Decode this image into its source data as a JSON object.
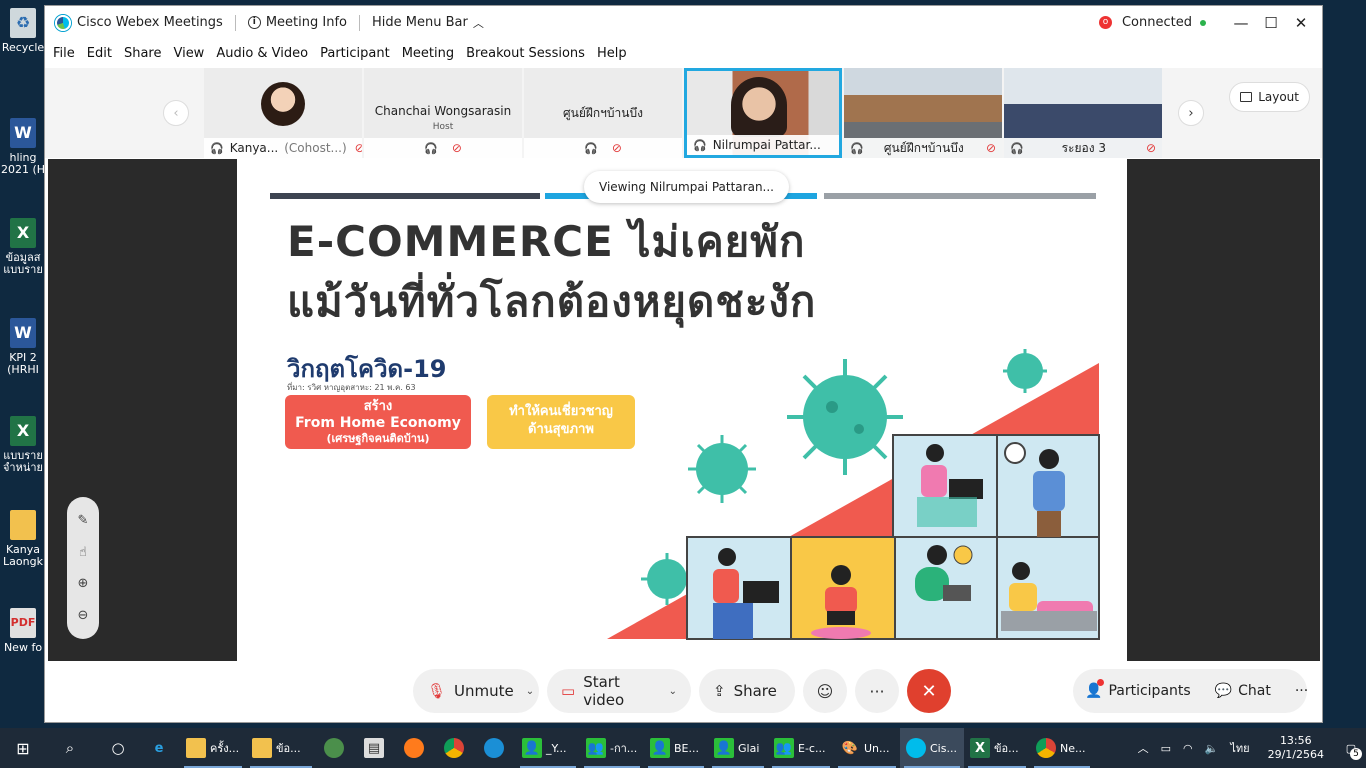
{
  "desktop": {
    "icons": [
      {
        "label": "Recycle",
        "type": "recycle",
        "glyph": "♻"
      },
      {
        "label": "hling 2021 (H",
        "type": "word",
        "glyph": "W"
      },
      {
        "label": "ข้อมูลส แบบราย",
        "type": "excel",
        "glyph": "X"
      },
      {
        "label": "KPI 2 (HRHI",
        "type": "word",
        "glyph": "W"
      },
      {
        "label": "แบบราย จำหน่าย",
        "type": "excel",
        "glyph": "X"
      },
      {
        "label": "Kanya Laongk",
        "type": "folder",
        "glyph": ""
      },
      {
        "label": "New fo",
        "type": "pdf",
        "glyph": "PDF"
      }
    ]
  },
  "titlebar": {
    "app_title": "Cisco Webex Meetings",
    "meeting_info": "Meeting Info",
    "hide_menu": "Hide Menu Bar",
    "status": "Connected"
  },
  "menu": [
    "File",
    "Edit",
    "Share",
    "View",
    "Audio & Video",
    "Participant",
    "Meeting",
    "Breakout Sessions",
    "Help"
  ],
  "participants": [
    {
      "name": "Kanya...",
      "role_tag": "(Cohost...)",
      "kind": "avatar"
    },
    {
      "name": "Chanchai Wongsarasin",
      "sub": "Host",
      "kind": "name-only"
    },
    {
      "name": "ศูนย์ฝึกฯบ้านบึง",
      "kind": "name-only"
    },
    {
      "name": "Nilrumpai Pattar...",
      "kind": "video-active"
    },
    {
      "name": "ศูนย์ฝึกฯบ้านบึง",
      "kind": "video"
    },
    {
      "name": "ระยอง 3",
      "kind": "video"
    }
  ],
  "layout_label": "Layout",
  "stage": {
    "viewing": "Viewing Nilrumpai Pattaran...",
    "slide": {
      "line1": "E-COMMERCE ไม่เคยพัก",
      "line2": "แม้วันที่ทั่วโลกต้องหยุดชะงัก",
      "covid_title": "วิกฤตโควิด-19",
      "covid_source": "ที่มา: รวิศ หาญอุตสาหะ: 21 พ.ค. 63",
      "box_red_1": "สร้าง",
      "box_red_2": "From Home Economy",
      "box_red_3": "(เศรษฐกิจคนติดบ้าน)",
      "box_yellow_1": "ทำให้คนเชี่ยวชาญ",
      "box_yellow_2": "ด้านสุขภาพ",
      "colors": {
        "red": "#f05a4f",
        "yellow": "#f9c847",
        "navy": "#1f3b6e",
        "teal": "#3fbfa8",
        "bar_dark": "#3d4451",
        "bar_blue": "#1ea5e0",
        "bar_gray": "#9aa0a6"
      }
    }
  },
  "controls": {
    "unmute": "Unmute",
    "start_video": "Start video",
    "share": "Share",
    "participants": "Participants",
    "chat": "Chat"
  },
  "taskbar": {
    "items": [
      {
        "label": "ครั้ง...",
        "icon": "folder"
      },
      {
        "label": "ข้อ...",
        "icon": "folder"
      },
      {
        "label": "_Y...",
        "icon": "line"
      },
      {
        "label": "-กา...",
        "icon": "line"
      },
      {
        "label": "BE...",
        "icon": "line"
      },
      {
        "label": "Glai",
        "icon": "line"
      },
      {
        "label": "E-c...",
        "icon": "line"
      },
      {
        "label": "Un...",
        "icon": "paint"
      },
      {
        "label": "Cis...",
        "icon": "webex"
      },
      {
        "label": "ข้อ...",
        "icon": "excel"
      },
      {
        "label": "Ne...",
        "icon": "chrome"
      }
    ],
    "lang": "ไทย",
    "time": "13:56",
    "date": "29/1/2564",
    "notif_count": "5"
  }
}
